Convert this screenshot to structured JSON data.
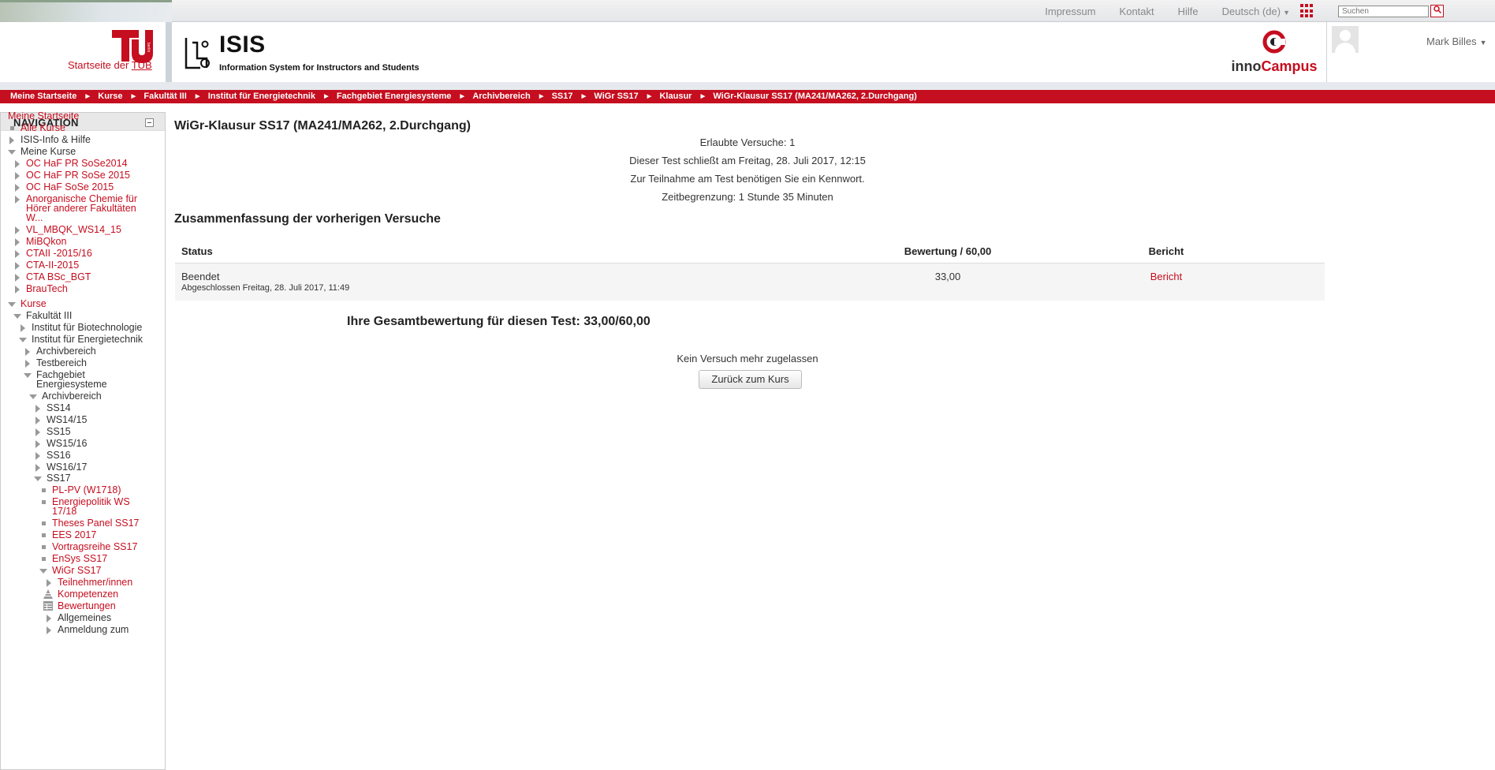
{
  "topbar": {
    "links": [
      "Impressum",
      "Kontakt",
      "Hilfe",
      "Deutsch (de)"
    ],
    "search_placeholder": "Suchen",
    "search_button": "🔍"
  },
  "header": {
    "tub_link_prefix": "Startseite der ",
    "tub_link_suffix": "TUB",
    "isis_title": "ISIS",
    "isis_subtitle": "Information System for Instructors and Students",
    "inno_left": "inno",
    "inno_right": "Campus",
    "user_name": "Mark Billes"
  },
  "breadcrumb": [
    "Meine Startseite",
    "Kurse",
    "Fakultät III",
    "Institut für Energietechnik",
    "Fachgebiet Energiesysteme",
    "Archivbereich",
    "SS17",
    "WiGr SS17",
    "Klausur",
    "WiGr-Klausur SS17 (MA241/MA262, 2.Durchgang)"
  ],
  "navigation": {
    "title": "NAVIGATION",
    "items": [
      {
        "label": "Meine Startseite",
        "color": "red",
        "marker": "none"
      },
      {
        "label": "Alle Kurse",
        "color": "red",
        "marker": "square"
      },
      {
        "label": "ISIS-Info & Hilfe",
        "color": "dark",
        "marker": "right"
      },
      {
        "label": "Meine Kurse",
        "color": "dark",
        "marker": "down"
      },
      {
        "label": "OC HaF PR SoSe2014",
        "color": "red",
        "marker": "right"
      },
      {
        "label": "OC HaF PR SoSe 2015",
        "color": "red",
        "marker": "right"
      },
      {
        "label": "OC HaF SoSe 2015",
        "color": "red",
        "marker": "right"
      },
      {
        "label": "Anorganische Chemie für",
        "color": "red",
        "marker": "right"
      },
      {
        "label": "Hörer anderer Fakultäten",
        "color": "red",
        "marker": "none"
      },
      {
        "label": "W...",
        "color": "red",
        "marker": "none"
      },
      {
        "label": "VL_MBQK_WS14_15",
        "color": "red",
        "marker": "right"
      },
      {
        "label": "MiBQkon",
        "color": "red",
        "marker": "right"
      },
      {
        "label": "CTAII -2015/16",
        "color": "red",
        "marker": "right"
      },
      {
        "label": "CTA-II-2015",
        "color": "red",
        "marker": "right"
      },
      {
        "label": "CTA BSc_BGT",
        "color": "red",
        "marker": "right"
      },
      {
        "label": "BrauTech",
        "color": "red",
        "marker": "right"
      },
      {
        "label": "Kurse",
        "color": "red",
        "marker": "down"
      },
      {
        "label": "Fakultät III",
        "color": "dark",
        "marker": "down"
      },
      {
        "label": "Institut für Biotechnologie",
        "color": "dark",
        "marker": "right"
      },
      {
        "label": "Institut für Energietechnik",
        "color": "dark",
        "marker": "down"
      },
      {
        "label": "Archivbereich",
        "color": "dark",
        "marker": "right"
      },
      {
        "label": "Testbereich",
        "color": "dark",
        "marker": "right"
      },
      {
        "label": "Fachgebiet",
        "color": "dark",
        "marker": "down"
      },
      {
        "label": "Energiesysteme",
        "color": "dark",
        "marker": "none"
      },
      {
        "label": "Archivbereich",
        "color": "dark",
        "marker": "down"
      },
      {
        "label": "SS14",
        "color": "dark",
        "marker": "right"
      },
      {
        "label": "WS14/15",
        "color": "dark",
        "marker": "right"
      },
      {
        "label": "SS15",
        "color": "dark",
        "marker": "right"
      },
      {
        "label": "WS15/16",
        "color": "dark",
        "marker": "right"
      },
      {
        "label": "SS16",
        "color": "dark",
        "marker": "right"
      },
      {
        "label": "WS16/17",
        "color": "dark",
        "marker": "right"
      },
      {
        "label": "SS17",
        "color": "dark",
        "marker": "down"
      },
      {
        "label": "PL-PV (W1718)",
        "color": "red",
        "marker": "square"
      },
      {
        "label": "Energiepolitik WS",
        "color": "red",
        "marker": "square"
      },
      {
        "label": "17/18",
        "color": "red",
        "marker": "none"
      },
      {
        "label": "Theses Panel SS17",
        "color": "red",
        "marker": "square"
      },
      {
        "label": "EES 2017",
        "color": "red",
        "marker": "square"
      },
      {
        "label": "Vortragsreihe SS17",
        "color": "red",
        "marker": "square"
      },
      {
        "label": "EnSys SS17",
        "color": "red",
        "marker": "square"
      },
      {
        "label": "WiGr SS17",
        "color": "red",
        "marker": "down"
      },
      {
        "label": "Teilnehmer/innen",
        "color": "red",
        "marker": "right"
      },
      {
        "label": "Kompetenzen",
        "color": "red",
        "marker": "competency-icon"
      },
      {
        "label": "Bewertungen",
        "color": "red",
        "marker": "grades-icon"
      },
      {
        "label": "Allgemeines",
        "color": "dark",
        "marker": "right"
      },
      {
        "label": "Anmeldung zum",
        "color": "dark",
        "marker": "right"
      }
    ]
  },
  "quiz": {
    "title": "WiGr-Klausur SS17 (MA241/MA262, 2.Durchgang)",
    "info_lines": [
      "Erlaubte Versuche: 1",
      "Dieser Test schließt am Freitag, 28. Juli 2017, 12:15",
      "Zur Teilnahme am Test benötigen Sie ein Kennwort.",
      "Zeitbegrenzung: 1 Stunde 35 Minuten"
    ],
    "summary_title": "Zusammenfassung der vorherigen Versuche",
    "table": {
      "headers": [
        "Status",
        "Bewertung / 60,00",
        "Bericht"
      ],
      "rows": [
        {
          "status": "Beendet",
          "status_detail": "Abgeschlossen Freitag, 28. Juli 2017, 11:49",
          "grade": "33,00",
          "report": "Bericht"
        }
      ]
    },
    "final_grade": "Ihre Gesamtbewertung für diesen Test: 33,00/60,00",
    "no_more_attempts": "Kein Versuch mehr zugelassen",
    "back_button": "Zurück zum Kurs"
  },
  "colors": {
    "accent": "#c50e1f",
    "breadcrumb_bg": "#c50e1f",
    "nav_header_bg": "#e8e8e8"
  }
}
